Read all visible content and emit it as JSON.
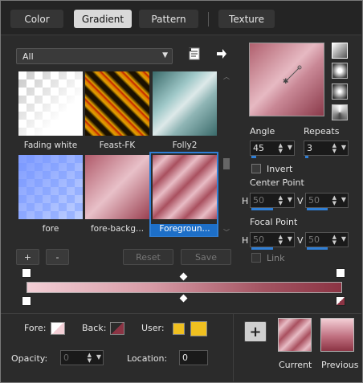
{
  "tabs": [
    {
      "label": "Color"
    },
    {
      "label": "Gradient"
    },
    {
      "label": "Pattern"
    },
    {
      "label": "Texture"
    }
  ],
  "library": {
    "filter": "All",
    "thumbnails": [
      {
        "label": "Fading white"
      },
      {
        "label": "Feast-FK"
      },
      {
        "label": "Folly2"
      },
      {
        "label": "fore"
      },
      {
        "label": "fore-backg..."
      },
      {
        "label": "Foregroun..."
      }
    ],
    "add_label": "+",
    "remove_label": "-",
    "reset_label": "Reset",
    "save_label": "Save"
  },
  "controls": {
    "angle_label": "Angle",
    "angle_value": "45",
    "repeats_label": "Repeats",
    "repeats_value": "3",
    "invert_label": "Invert",
    "center_point_label": "Center Point",
    "center_h_label": "H",
    "center_h_value": "50",
    "center_v_label": "V",
    "center_v_value": "50",
    "focal_point_label": "Focal Point",
    "focal_h_label": "H",
    "focal_h_value": "50",
    "focal_v_label": "V",
    "focal_v_value": "50",
    "link_label": "Link"
  },
  "bottom": {
    "fore_label": "Fore:",
    "back_label": "Back:",
    "user_label": "User:",
    "opacity_label": "Opacity:",
    "opacity_value": "0",
    "location_label": "Location:",
    "location_value": "0",
    "add_button": "+",
    "current_label": "Current",
    "previous_label": "Previous"
  },
  "colors": {
    "accent": "#2f7fd6",
    "user_swatch": "#f0c020",
    "gradient_start": "#f3cfd6",
    "gradient_end": "#8c3444"
  }
}
